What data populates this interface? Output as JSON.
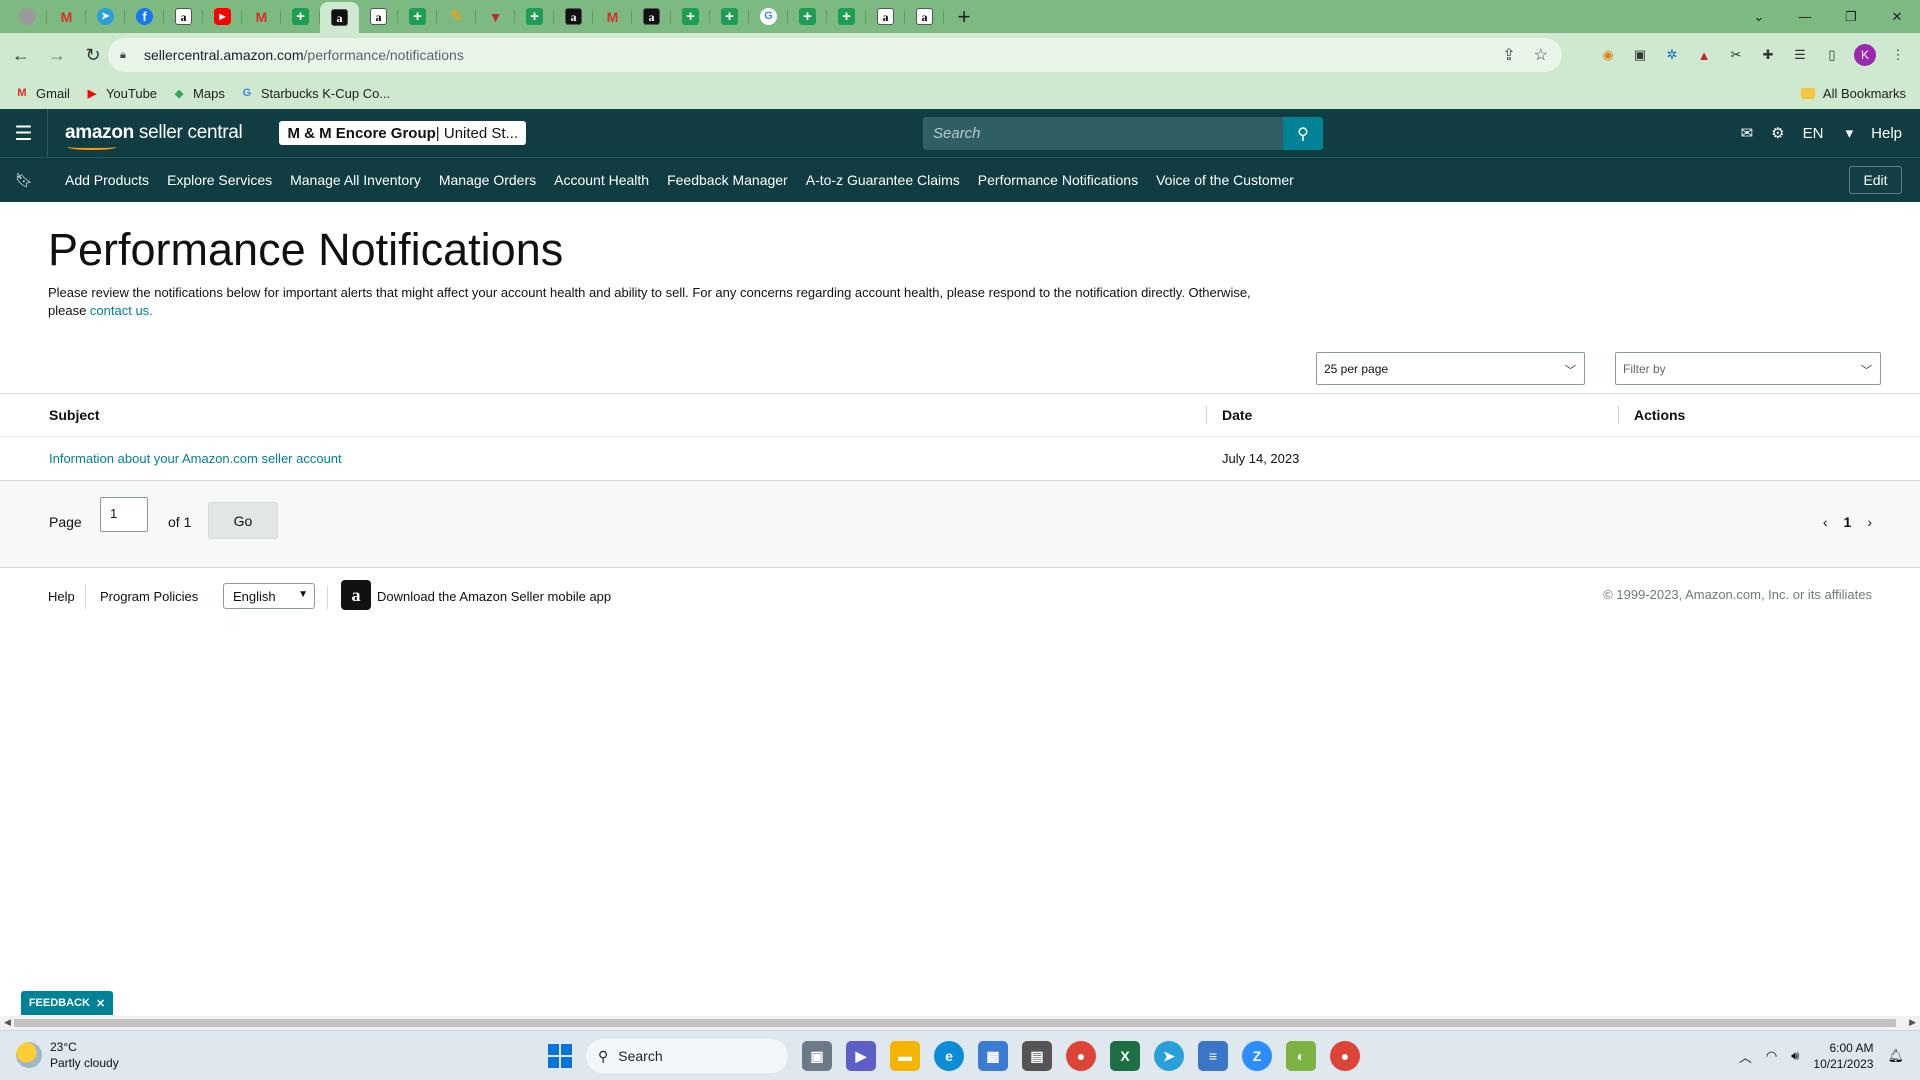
{
  "browser": {
    "url_domain": "sellercentral.amazon.com",
    "url_path": "/performance/notifications",
    "bookmarks": [
      {
        "label": "Gmail",
        "icon": "gmail-icon"
      },
      {
        "label": "YouTube",
        "icon": "youtube-icon"
      },
      {
        "label": "Maps",
        "icon": "maps-icon"
      },
      {
        "label": "Starbucks K-Cup Co...",
        "icon": "google-icon"
      }
    ],
    "all_bookmarks": "All Bookmarks",
    "profile_initial": "K"
  },
  "header": {
    "logo_bold": "amazon",
    "logo_rest": " seller central",
    "store_name": "M & M Encore Group",
    "store_region": " | United St...",
    "search_placeholder": "Search",
    "language": "EN",
    "help": "Help"
  },
  "nav": {
    "items": [
      "Add Products",
      "Explore Services",
      "Manage All Inventory",
      "Manage Orders",
      "Account Health",
      "Feedback Manager",
      "A-to-z Guarantee Claims",
      "Performance Notifications",
      "Voice of the Customer"
    ],
    "edit": "Edit"
  },
  "page": {
    "title": "Performance Notifications",
    "description": "Please review the notifications below for important alerts that might affect your account health and ability to sell. For any concerns regarding account health, please respond to the notification directly. Otherwise, please ",
    "contact_link": "contact us.",
    "per_page": "25 per page",
    "filter_placeholder": "Filter by"
  },
  "table": {
    "headers": {
      "subject": "Subject",
      "date": "Date",
      "actions": "Actions"
    },
    "rows": [
      {
        "subject": "Information about your Amazon.com seller account",
        "date": "July 14, 2023",
        "actions": ""
      }
    ]
  },
  "pagination": {
    "page_label": "Page",
    "page_value": "1",
    "of_label": "of 1",
    "go": "Go",
    "current": "1"
  },
  "footer": {
    "help": "Help",
    "program_policies": "Program Policies",
    "language": "English",
    "app_download": "Download the Amazon Seller mobile app",
    "copyright": "© 1999-2023, Amazon.com, Inc. or its affiliates"
  },
  "feedback": "FEEDBACK",
  "taskbar": {
    "temperature": "23°C",
    "weather": "Partly cloudy",
    "search": "Search",
    "time": "6:00 AM",
    "date": "10/21/2023"
  },
  "colors": {
    "header_bg": "#0f3d42",
    "accent": "#008296",
    "browser_frame": "#7dba82"
  }
}
